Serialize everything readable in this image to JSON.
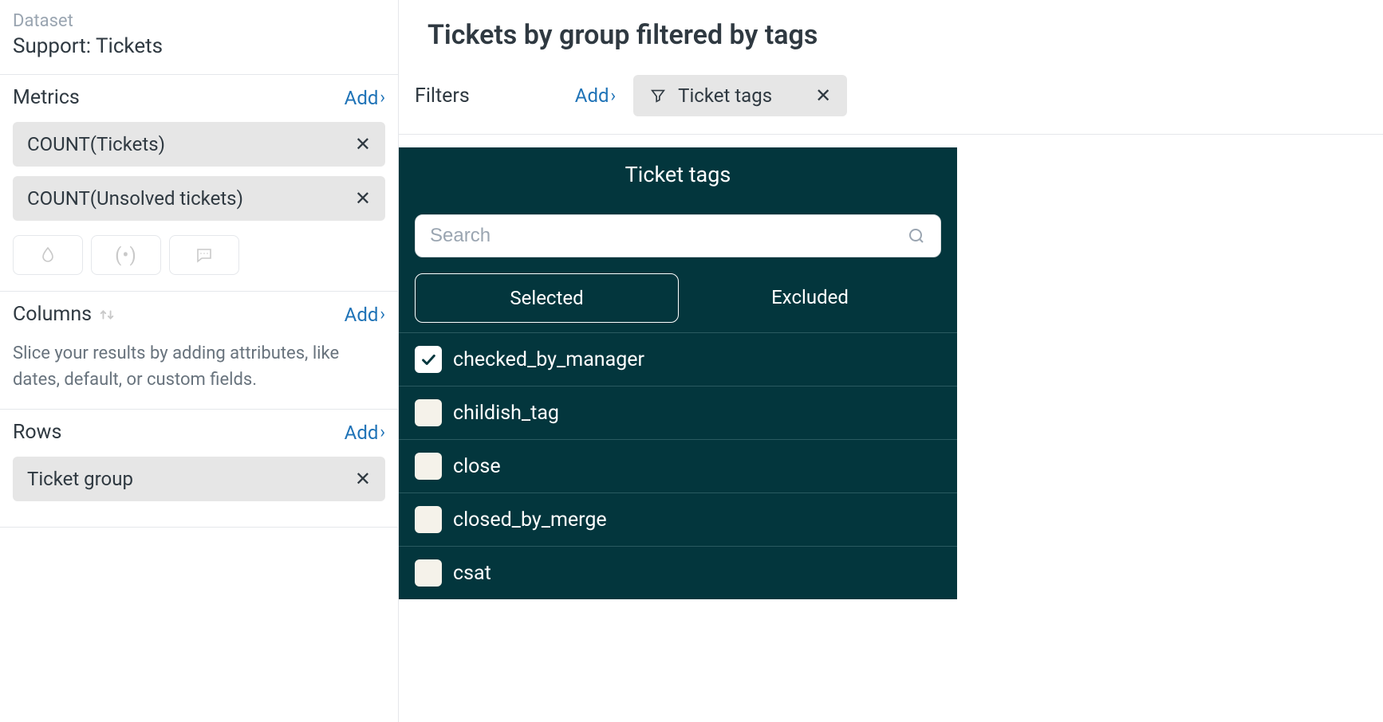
{
  "sidebar": {
    "dataset_label": "Dataset",
    "dataset_name": "Support: Tickets",
    "metrics": {
      "title": "Metrics",
      "add_label": "Add",
      "items": [
        {
          "label": "COUNT(Tickets)"
        },
        {
          "label": "COUNT(Unsolved tickets)"
        }
      ]
    },
    "columns": {
      "title": "Columns",
      "add_label": "Add",
      "help": "Slice your results by adding attributes, like dates, default, or custom fields."
    },
    "rows": {
      "title": "Rows",
      "add_label": "Add",
      "items": [
        {
          "label": "Ticket group"
        }
      ]
    }
  },
  "main": {
    "title": "Tickets by group filtered by tags",
    "filters": {
      "label": "Filters",
      "add_label": "Add",
      "chip_label": "Ticket tags"
    }
  },
  "dropdown": {
    "title": "Ticket tags",
    "search_placeholder": "Search",
    "tabs": {
      "selected": "Selected",
      "excluded": "Excluded"
    },
    "tags": [
      {
        "label": "checked_by_manager",
        "checked": true
      },
      {
        "label": "childish_tag",
        "checked": false
      },
      {
        "label": "close",
        "checked": false
      },
      {
        "label": "closed_by_merge",
        "checked": false
      },
      {
        "label": "csat",
        "checked": false
      }
    ]
  }
}
